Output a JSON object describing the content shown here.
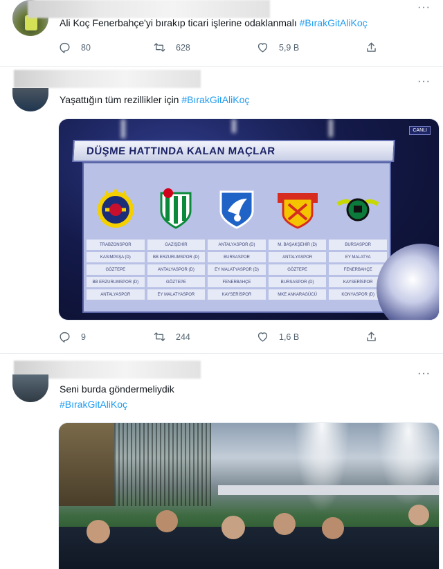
{
  "tweets": [
    {
      "text": "Ali Koç Fenerbahçe'yi bırakıp ticari işlerine odaklanmalı ",
      "hashtag": "#BırakGitAliKoç",
      "actions": {
        "replies": "80",
        "retweets": "628",
        "likes": "5,9 B"
      }
    },
    {
      "text": "Yaşattığın tüm rezillikler için ",
      "hashtag": "#BırakGitAliKoç",
      "actions": {
        "replies": "9",
        "retweets": "244",
        "likes": "1,6 B"
      },
      "media": {
        "banner": "DÜŞME HATTINDA KALAN MAÇLAR",
        "badge": "CANLI",
        "columns": [
          {
            "rows": [
              "TRABZONSPOR",
              "KASIMPAŞA (D)",
              "GÖZTEPE",
              "BB ERZURUMSPOR (D)",
              "ANTALYASPOR"
            ]
          },
          {
            "rows": [
              "GAZİŞEHİR",
              "BB ERZURUMSPOR (D)",
              "ANTALYASPOR (D)",
              "GÖZTEPE",
              "EY MALATYASPOR"
            ]
          },
          {
            "rows": [
              "ANTALYASPOR (D)",
              "BURSASPOR",
              "EY MALATYASPOR (D)",
              "FENERBAHÇE",
              "KAYSERİSPOR"
            ]
          },
          {
            "rows": [
              "M. BAŞAKŞEHİR (D)",
              "ANTALYASPOR",
              "GÖZTEPE",
              "BURSASPOR (D)",
              "MKE ANKARAGÜCÜ"
            ]
          },
          {
            "rows": [
              "BURSASPOR",
              "EY MALATYA",
              "FENERBAHÇE",
              "KAYSERİSPOR",
              "KONYASPOR (D)"
            ]
          }
        ]
      }
    },
    {
      "text": "Seni burda göndermeliydik",
      "hashtag": "#BırakGitAliKoç"
    }
  ],
  "colors": {
    "accent": "#1d9bf0",
    "muted": "#536471"
  },
  "icons": {
    "reply": "reply-icon",
    "retweet": "retweet-icon",
    "like": "heart-icon",
    "share": "share-icon",
    "more": "more-icon"
  }
}
